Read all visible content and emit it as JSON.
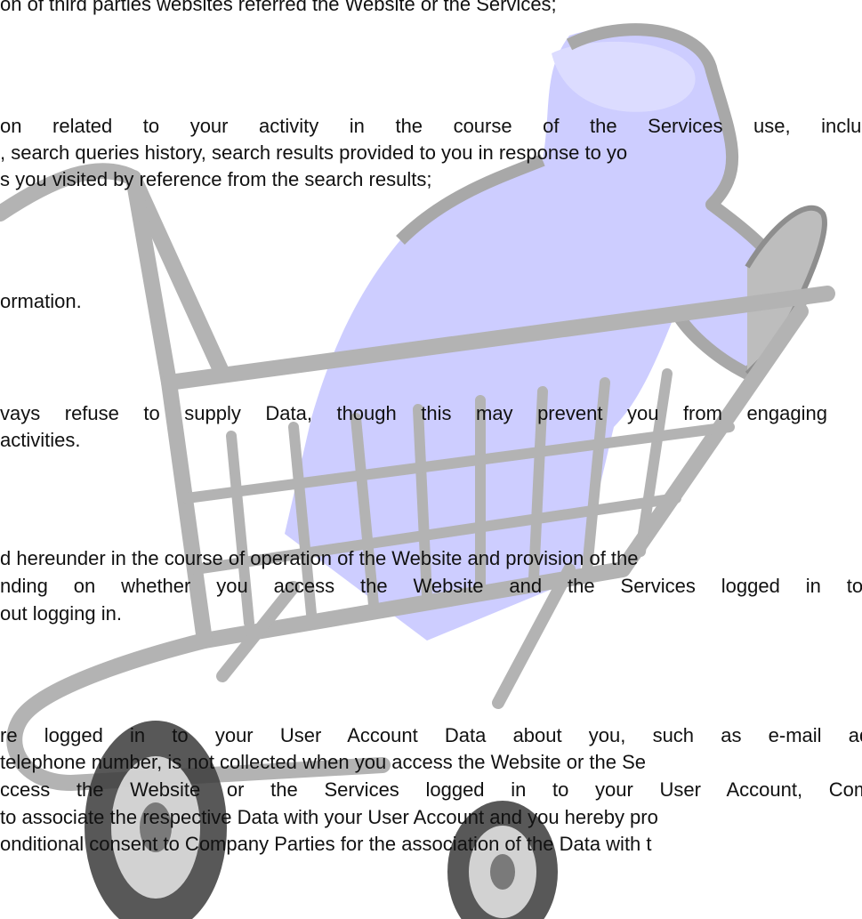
{
  "document": {
    "paragraphs": [
      {
        "id": "p1",
        "lines": [
          "on of third parties websites referred the Website or the Services;"
        ]
      },
      {
        "id": "p2",
        "lines": [
          "on related to your activity in the course of the Services use, including",
          ", search queries history, search results provided to you in response to yo",
          "s you visited by reference from the search results;"
        ]
      },
      {
        "id": "p3",
        "lines": [
          "ormation."
        ]
      },
      {
        "id": "p4",
        "lines": [
          "vays refuse to supply Data, though this may prevent you from engaging",
          "activities."
        ]
      },
      {
        "id": "p5",
        "lines": [
          "d hereunder in the course of operation of the Website and provision of the",
          "nding on whether you access the Website and the Services logged in to y",
          "out logging in."
        ]
      },
      {
        "id": "p6",
        "lines": [
          "re logged in to your User Account Data about you, such as e-mail addre",
          "telephone number, is not collected when you access the Website or the Se",
          "ccess the Website or the Services logged in to your User Account, Compar",
          "to associate the respective Data with your User Account and you hereby pro",
          "onditional consent to Company Parties for the association of the Data with t"
        ]
      }
    ]
  },
  "watermark": {
    "subject": "shopping-cart-with-figure",
    "colors": {
      "frame": "#b0b0b0",
      "frame_dark": "#8e8e8e",
      "figure": "#c9c9ff",
      "wheel": "#4a4a4a"
    }
  }
}
